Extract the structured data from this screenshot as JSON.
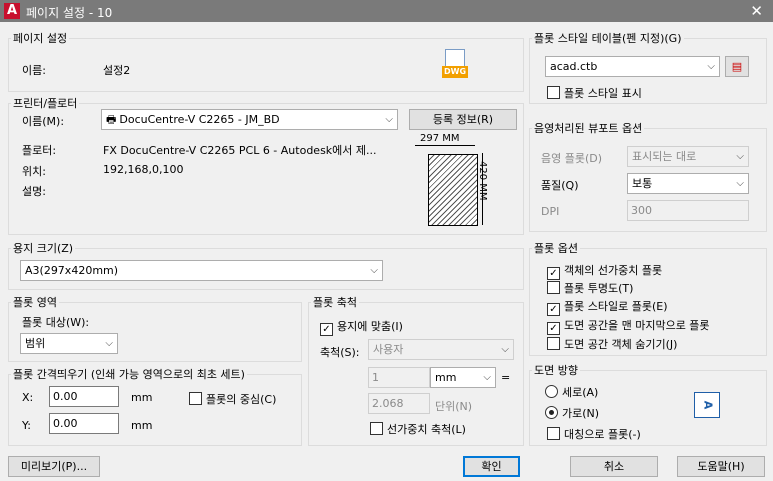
{
  "title": "페이지 설정 - 10",
  "page_setup": {
    "legend": "페이지 설정",
    "name_label": "이름:",
    "name_value": "설정2",
    "dwg_icon": "DWG"
  },
  "printer": {
    "legend": "프린터/플로터",
    "name_label": "이름(M):",
    "name_value": "DocuCentre-V C2265 - JM_BD",
    "properties_button": "등록 정보(R)",
    "plotter_label": "플로터:",
    "plotter_value": "FX DocuCentre-V C2265 PCL 6 - Autodesk에서 제...",
    "location_label": "위치:",
    "location_value": "192,168,0,100",
    "description_label": "설명:",
    "preview_width": "297 MM",
    "preview_height": "420 MM"
  },
  "paper_size": {
    "legend": "용지 크기(Z)",
    "value": "A3(297x420mm)"
  },
  "plot_area": {
    "legend": "플롯 영역",
    "what_label": "플롯 대상(W):",
    "what_value": "범위"
  },
  "plot_offset": {
    "legend": "플롯 간격띄우기 (인쇄 가능 영역으로의 최초 세트)",
    "x_label": "X:",
    "x_value": "0.00",
    "x_unit": "mm",
    "y_label": "Y:",
    "y_value": "0.00",
    "y_unit": "mm",
    "center_label": "플롯의 중심(C)"
  },
  "plot_scale": {
    "legend": "플롯 축척",
    "fit_label": "용지에 맞춤(I)",
    "scale_label": "축척(S):",
    "scale_value": "사용자",
    "value1": "1",
    "unit_value": "mm",
    "equals": "=",
    "value2": "2.068",
    "unit2": "단위(N)",
    "lineweights_label": "선가중치 축척(L)"
  },
  "plot_style_table": {
    "legend": "플롯 스타일 테이블(펜 지정)(G)",
    "value": "acad.ctb",
    "display_label": "플롯 스타일 표시"
  },
  "shaded_viewport": {
    "legend": "음영처리된 뷰포트 옵션",
    "shade_label": "음영 플롯(D)",
    "shade_value": "표시되는 대로",
    "quality_label": "품질(Q)",
    "quality_value": "보통",
    "dpi_label": "DPI",
    "dpi_value": "300"
  },
  "plot_options": {
    "legend": "플롯 옵션",
    "items": [
      {
        "label": "객체의 선가중치 플롯",
        "mark": "✓"
      },
      {
        "label": "플롯 투명도(T)",
        "mark": ""
      },
      {
        "label": "플롯 스타일로 플롯(E)",
        "mark": "✓"
      },
      {
        "label": "도면 공간을 맨 마지막으로 플롯",
        "mark": "✓"
      },
      {
        "label": "도면 공간 객체 숨기기(J)",
        "mark": ""
      }
    ]
  },
  "orientation": {
    "legend": "도면 방향",
    "portrait": "세로(A)",
    "landscape": "가로(N)",
    "upside_down": "대칭으로 플롯(-)",
    "preview_letter": "A"
  },
  "buttons": {
    "preview": "미리보기(P)...",
    "ok": "확인",
    "cancel": "취소",
    "help": "도움말(H)"
  }
}
